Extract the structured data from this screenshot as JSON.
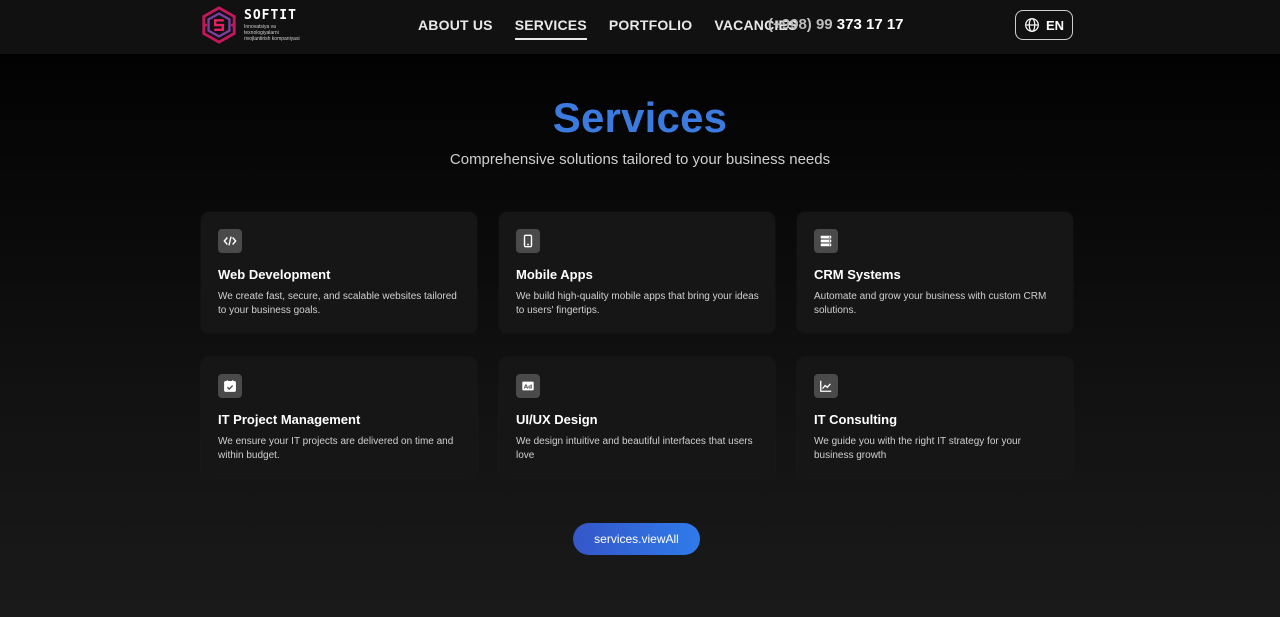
{
  "brand": {
    "name": "SOFTIT",
    "tagline": "Innovatsiya va texnologiyalarni rivojlantirish kompaniyasi",
    "colors": {
      "magenta": "#c2185b",
      "purple": "#7b3fa0"
    }
  },
  "nav": {
    "items": [
      {
        "label": "ABOUT US",
        "active": false
      },
      {
        "label": "SERVICES",
        "active": true
      },
      {
        "label": "PORTFOLIO",
        "active": false
      },
      {
        "label": "VACANCIES",
        "active": false
      }
    ],
    "phone_prefix": "(+998) 99 ",
    "phone_number": "373 17 17",
    "language": "EN",
    "language_icon": "globe-icon"
  },
  "section": {
    "title": "Services",
    "subtitle": "Comprehensive solutions tailored to your business needs",
    "accent": "#3b7be0"
  },
  "services": [
    {
      "icon": "code-icon",
      "title": "Web Development",
      "description": "We create fast, secure, and scalable websites tailored to your business goals."
    },
    {
      "icon": "smartphone-icon",
      "title": "Mobile Apps",
      "description": "We build high-quality mobile apps that bring your ideas to users' fingertips."
    },
    {
      "icon": "server-icon",
      "title": "CRM Systems",
      "description": "Automate and grow your business with custom CRM solutions."
    },
    {
      "icon": "calendar-check-icon",
      "title": "IT Project Management",
      "description": "We ensure your IT projects are delivered on time and within budget."
    },
    {
      "icon": "ad-icon",
      "title": "UI/UX Design",
      "description": "We design intuitive and beautiful interfaces that users love"
    },
    {
      "icon": "trending-up-icon",
      "title": "IT Consulting",
      "description": "We guide you with the right IT strategy for your business growth"
    }
  ],
  "view_all_label": "services.viewAll"
}
